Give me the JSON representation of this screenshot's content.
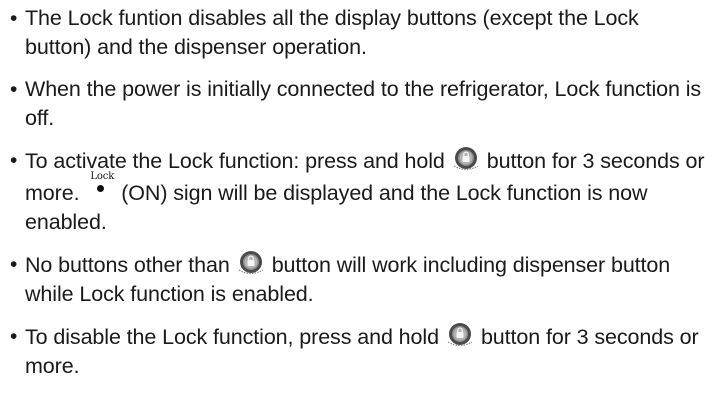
{
  "bullet_symbol": "•",
  "items": [
    {
      "text": "The Lock funtion disables all the display buttons (except the Lock button) and the dispenser operation."
    },
    {
      "text": "When the power is initially connected to the refrigerator, Lock function is off."
    },
    {
      "part1": "To activate the Lock function: press and hold",
      "part2": "button for 3 seconds or more.",
      "lock_sign_label": "Lock",
      "part3": "(ON) sign will be displayed and the Lock function is now enabled."
    },
    {
      "part1": "No buttons other than",
      "part2": "button will work including dispenser button while Lock function is enabled."
    },
    {
      "part1": "To disable the Lock function, press and hold",
      "part2": "button for 3 seconds or more."
    }
  ],
  "icons": {
    "lock_button": "lock-button-icon",
    "lock_sign": "lock-on-indicator-icon"
  }
}
